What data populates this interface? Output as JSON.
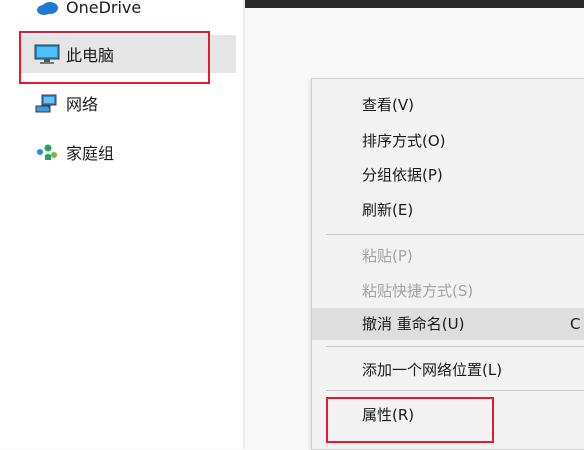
{
  "nav": {
    "onedrive": "OneDrive",
    "this_pc": "此电脑",
    "network": "网络",
    "homegroup": "家庭组"
  },
  "context_menu": {
    "items": [
      {
        "label": "查看(V)",
        "enabled": true
      },
      {
        "label": "排序方式(O)",
        "enabled": true
      },
      {
        "label": "分组依据(P)",
        "enabled": true
      },
      {
        "label": "刷新(E)",
        "enabled": true
      },
      {
        "label": "粘贴(P)",
        "enabled": false
      },
      {
        "label": "粘贴快捷方式(S)",
        "enabled": false
      },
      {
        "label": "撤消 重命名(U)",
        "enabled": true,
        "shortcut": "C"
      },
      {
        "label": "添加一个网络位置(L)",
        "enabled": true
      },
      {
        "label": "属性(R)",
        "enabled": true
      }
    ]
  },
  "colors": {
    "highlight_box": "#e8192c",
    "disabled_text": "#a3a3a3"
  }
}
